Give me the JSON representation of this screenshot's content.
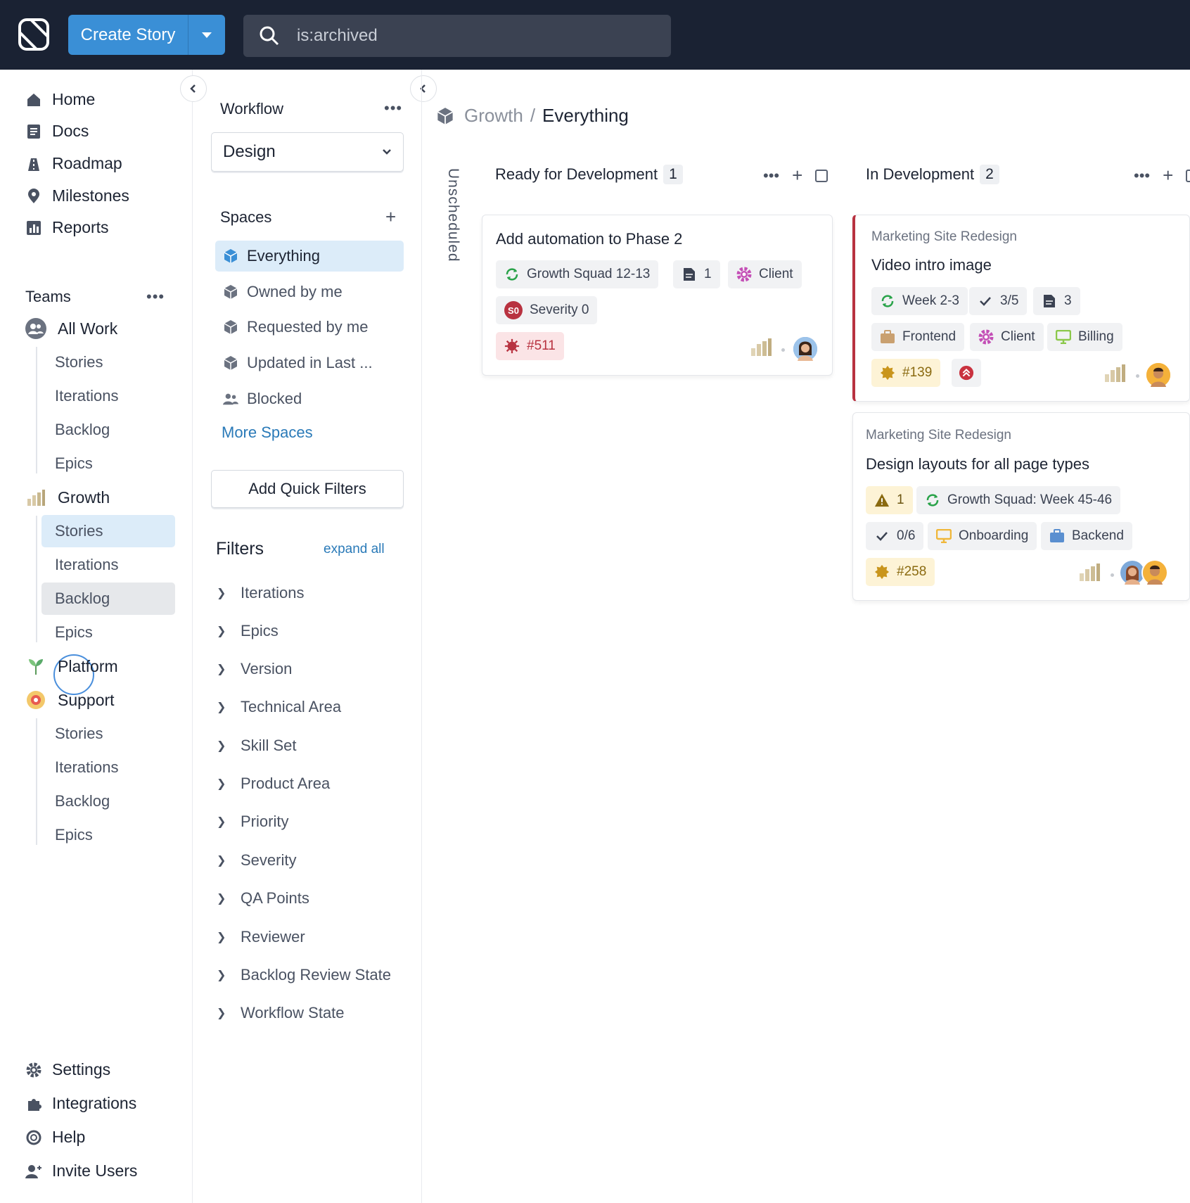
{
  "topbar": {
    "create_label": "Create Story",
    "search_value": "is:archived"
  },
  "leftnav": {
    "main": [
      {
        "label": "Home",
        "icon": "home-icon"
      },
      {
        "label": "Docs",
        "icon": "docs-icon"
      },
      {
        "label": "Roadmap",
        "icon": "roadmap-icon"
      },
      {
        "label": "Milestones",
        "icon": "milestone-icon"
      },
      {
        "label": "Reports",
        "icon": "reports-icon"
      }
    ],
    "teams_label": "Teams",
    "all_work": {
      "label": "All Work",
      "items": [
        "Stories",
        "Iterations",
        "Backlog",
        "Epics"
      ]
    },
    "growth": {
      "label": "Growth",
      "items": [
        "Stories",
        "Iterations",
        "Backlog",
        "Epics"
      ]
    },
    "platform": {
      "label": "Platform"
    },
    "support": {
      "label": "Support",
      "items": [
        "Stories",
        "Iterations",
        "Backlog",
        "Epics"
      ]
    },
    "bottom": [
      {
        "label": "Settings",
        "icon": "gear-icon"
      },
      {
        "label": "Integrations",
        "icon": "puzzle-icon"
      },
      {
        "label": "Help",
        "icon": "help-icon"
      },
      {
        "label": "Invite Users",
        "icon": "invite-user-icon"
      }
    ]
  },
  "midpanel": {
    "workflow_label": "Workflow",
    "workflow_value": "Design",
    "spaces_label": "Spaces",
    "spaces": [
      "Everything",
      "Owned by me",
      "Requested by me",
      "Updated in Last ...",
      "Blocked"
    ],
    "more_spaces": "More Spaces",
    "add_quick_filters": "Add Quick Filters",
    "filters_label": "Filters",
    "expand_all": "expand all",
    "filters": [
      "Iterations",
      "Epics",
      "Version",
      "Technical Area",
      "Skill Set",
      "Product Area",
      "Priority",
      "Severity",
      "QA Points",
      "Reviewer",
      "Backlog Review State",
      "Workflow State"
    ]
  },
  "main": {
    "breadcrumb_parent": "Growth",
    "breadcrumb_sep": "/",
    "breadcrumb_current": "Everything",
    "unscheduled": "Unscheduled",
    "columns": [
      {
        "name": "Ready for Development",
        "count": "1"
      },
      {
        "name": "In Development",
        "count": "2"
      }
    ],
    "cards": {
      "c1": {
        "title": "Add automation to Phase 2",
        "iteration": "Growth Squad 12-13",
        "docs": "1",
        "label": "Client",
        "severity": "Severity 0",
        "severity_badge": "S0",
        "id": "#511"
      },
      "c2": {
        "epic": "Marketing Site Redesign",
        "title": "Video intro image",
        "iteration": "Week 2-3",
        "tasks": "3/5",
        "docs": "3",
        "label1": "Frontend",
        "label2": "Client",
        "label3": "Billing",
        "id": "#139"
      },
      "c3": {
        "epic": "Marketing Site Redesign",
        "title": "Design layouts for all page types",
        "warn": "1",
        "iteration": "Growth Squad: Week 45-46",
        "tasks": "0/6",
        "label1": "Onboarding",
        "label2": "Backend",
        "id": "#258"
      }
    }
  },
  "colors": {
    "accent": "#3a8fd6",
    "topbar": "#1a2233",
    "active_bg": "#dcecf9",
    "bug_red": "#b83240",
    "feature_yellow": "#c9951c"
  }
}
